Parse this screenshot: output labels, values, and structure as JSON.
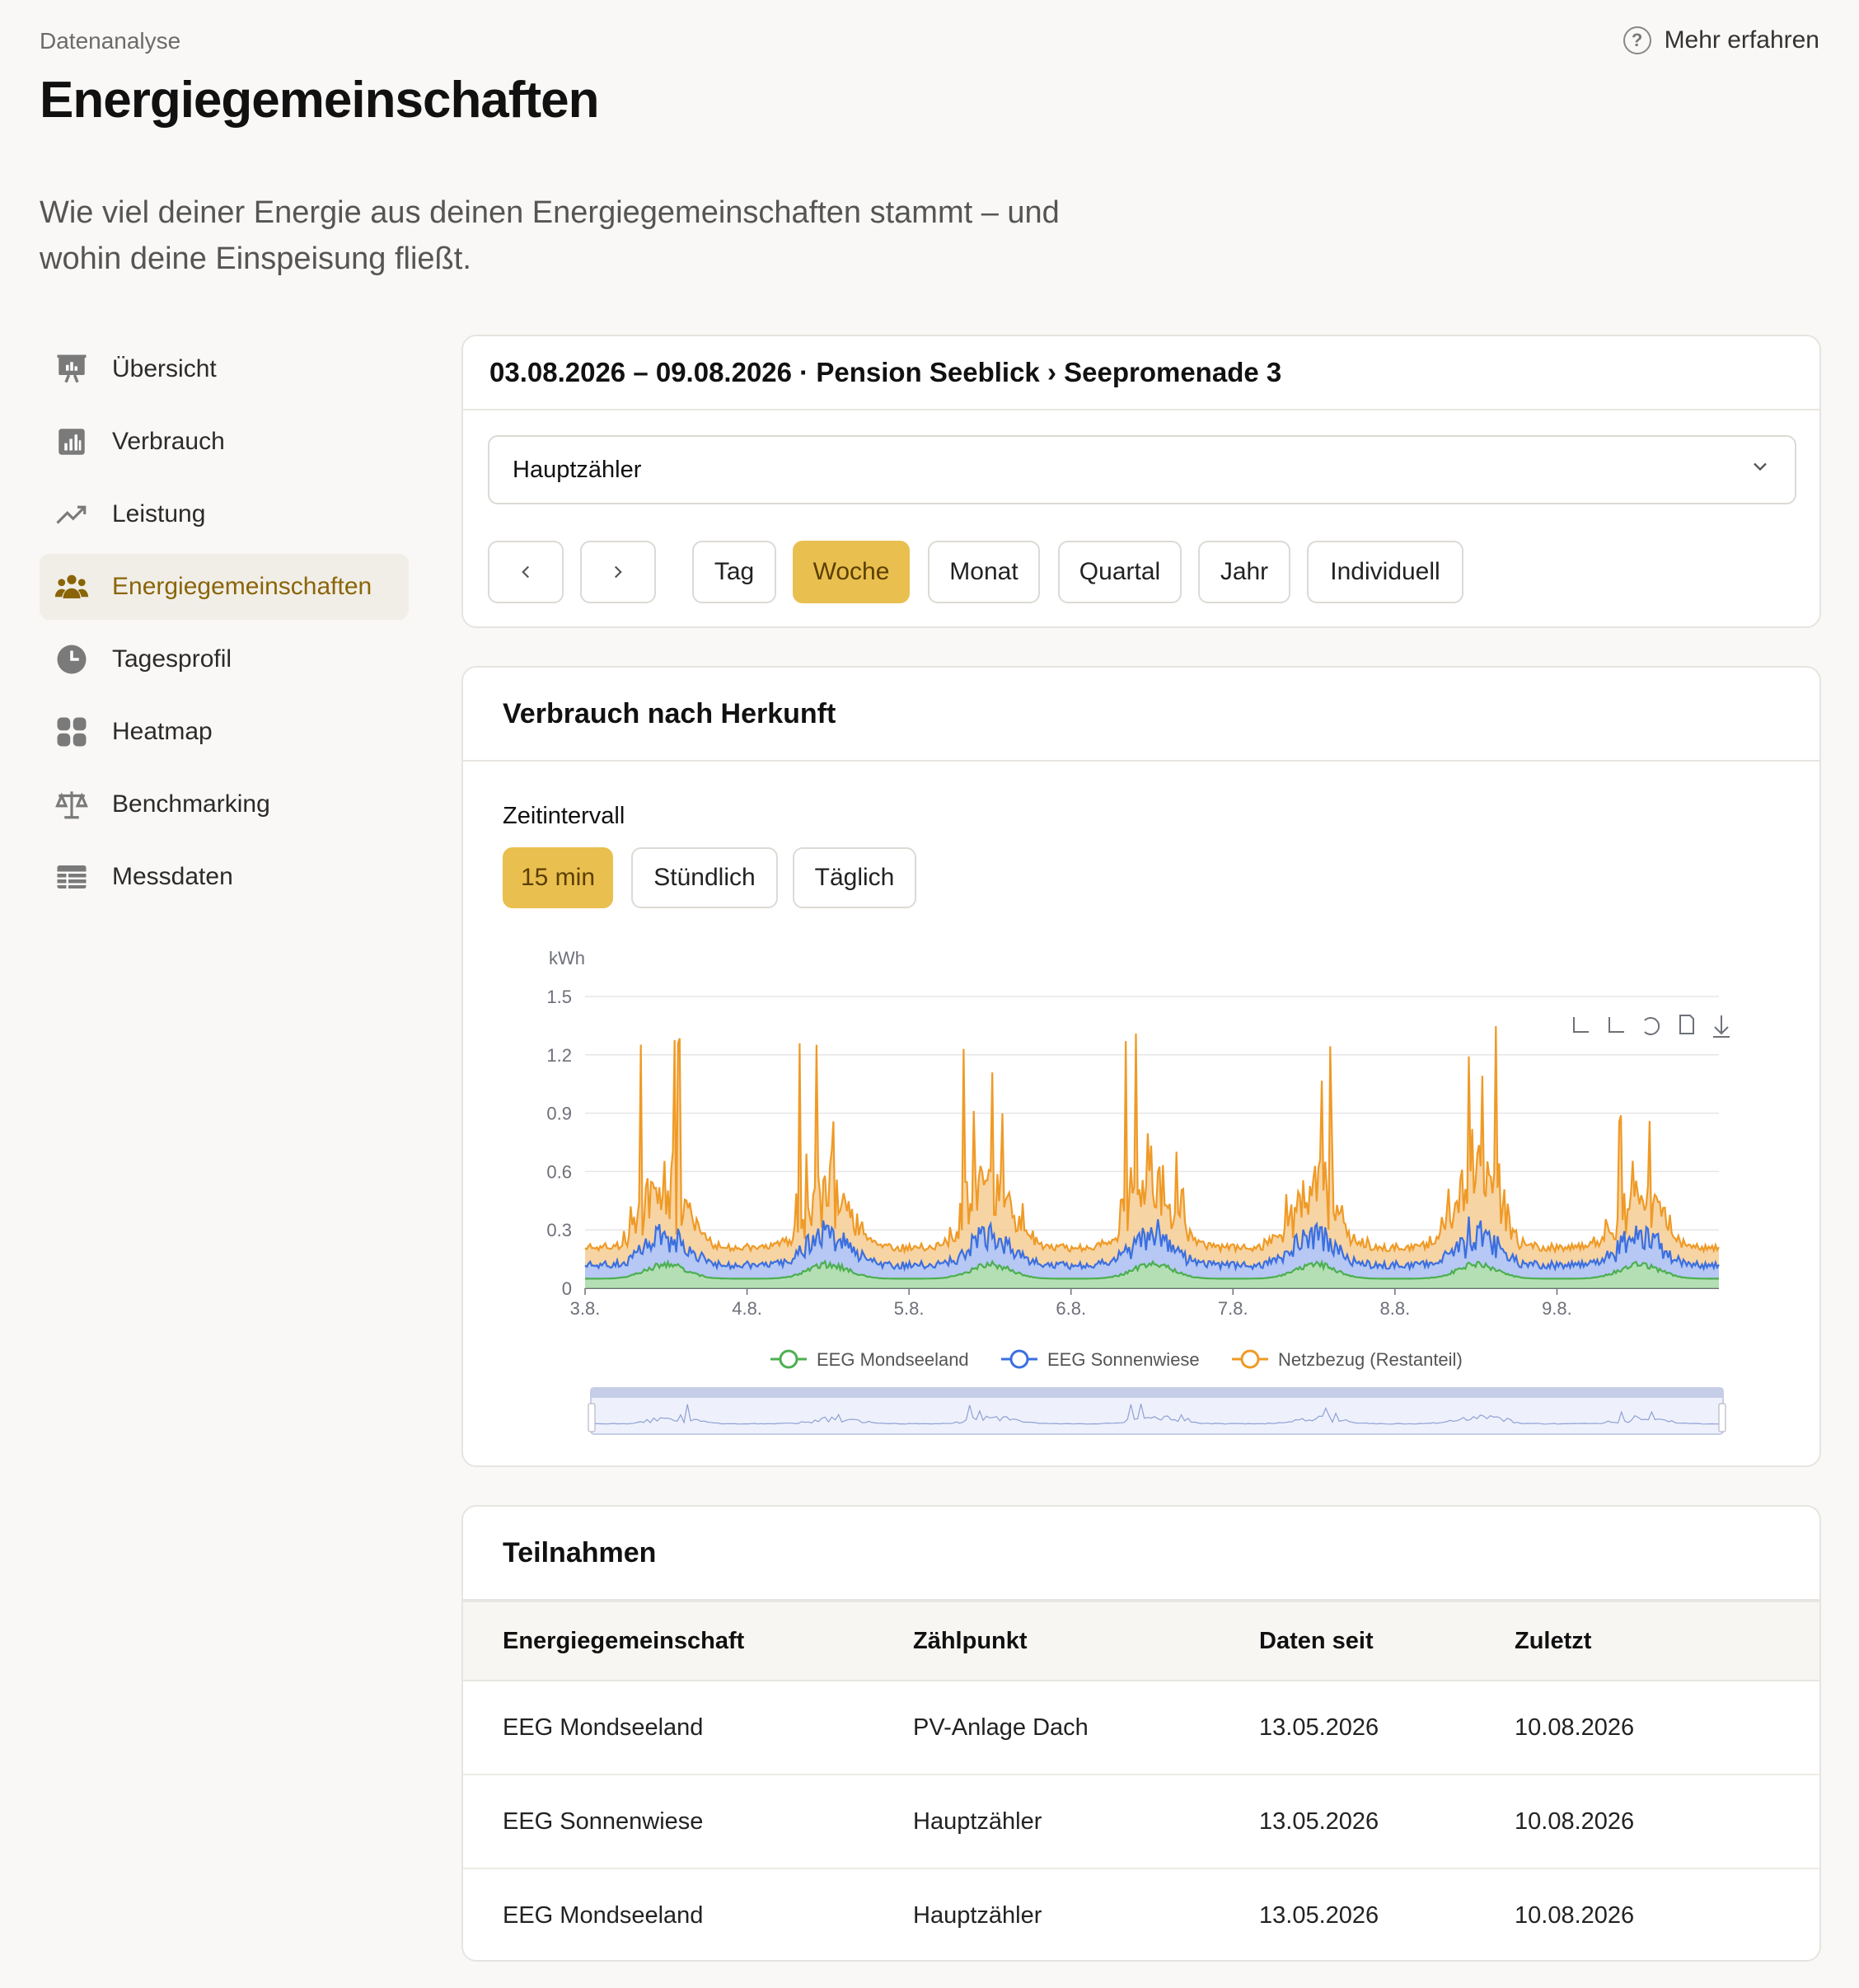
{
  "header": {
    "breadcrumb": "Datenanalyse",
    "learn_more": "Mehr erfahren",
    "title": "Energiegemeinschaften",
    "subtitle": "Wie viel deiner Energie aus deinen Energiegemeinschaften stammt – und wohin deine Einspeisung fließt."
  },
  "sidebar": {
    "items": [
      {
        "label": "Übersicht",
        "icon": "presentation-chart-icon"
      },
      {
        "label": "Verbrauch",
        "icon": "bar-chart-icon"
      },
      {
        "label": "Leistung",
        "icon": "trend-up-icon"
      },
      {
        "label": "Energiegemeinschaften",
        "icon": "users-group-icon",
        "active": true
      },
      {
        "label": "Tagesprofil",
        "icon": "clock-icon"
      },
      {
        "label": "Heatmap",
        "icon": "grid-icon"
      },
      {
        "label": "Benchmarking",
        "icon": "scale-icon"
      },
      {
        "label": "Messdaten",
        "icon": "table-icon"
      }
    ]
  },
  "filter": {
    "heading": "03.08.2026 – 09.08.2026 · Pension Seeblick › Seepromenade 3",
    "meter": "Hauptzähler",
    "periods": [
      "Tag",
      "Woche",
      "Monat",
      "Quartal",
      "Jahr",
      "Individuell"
    ],
    "selected_period": "Woche"
  },
  "chart_card": {
    "title": "Verbrauch nach Herkunft",
    "interval_label": "Zeitintervall",
    "intervals": [
      "15 min",
      "Stündlich",
      "Täglich"
    ],
    "selected_interval": "15 min"
  },
  "chart_data": {
    "type": "area",
    "stacked": true,
    "ylabel": "kWh",
    "ylim": [
      0,
      1.5
    ],
    "yticks": [
      "0",
      "0.3",
      "0.6",
      "0.9",
      "1.2",
      "1.5"
    ],
    "xticks": [
      "3.8.",
      "4.8.",
      "5.8.",
      "6.8.",
      "7.8.",
      "8.8.",
      "9.8."
    ],
    "x_days": [
      "3.8.",
      "4.8.",
      "5.8.",
      "6.8.",
      "7.8.",
      "8.8.",
      "9.8."
    ],
    "colors": {
      "EEG Mondseeland": "#4caf50",
      "EEG Sonnenwiese": "#3b6fe0",
      "Netzbezug (Restanteil)": "#ef9a26"
    },
    "series": [
      {
        "name": "EEG Mondseeland",
        "typical": 0.07,
        "peak": 0.14
      },
      {
        "name": "EEG Sonnenwiese",
        "typical": 0.1,
        "peak": 0.22
      },
      {
        "name": "Netzbezug (Restanteil)",
        "typical": 0.15,
        "peak": 0.9
      }
    ],
    "daily_peak_total": [
      1.3,
      1.28,
      1.28,
      1.31,
      1.26,
      1.35,
      0.9
    ],
    "legend": [
      "EEG Mondseeland",
      "EEG Sonnenwiese",
      "Netzbezug (Restanteil)"
    ],
    "legend_position": "bottom",
    "grid": true,
    "dataZoom": true
  },
  "participations": {
    "title": "Teilnahmen",
    "columns": [
      "Energiegemeinschaft",
      "Zählpunkt",
      "Daten seit",
      "Zuletzt"
    ],
    "rows": [
      [
        "EEG Mondseeland",
        "PV-Anlage Dach",
        "13.05.2026",
        "10.08.2026"
      ],
      [
        "EEG Sonnenwiese",
        "Hauptzähler",
        "13.05.2026",
        "10.08.2026"
      ],
      [
        "EEG Mondseeland",
        "Hauptzähler",
        "13.05.2026",
        "10.08.2026"
      ]
    ]
  }
}
